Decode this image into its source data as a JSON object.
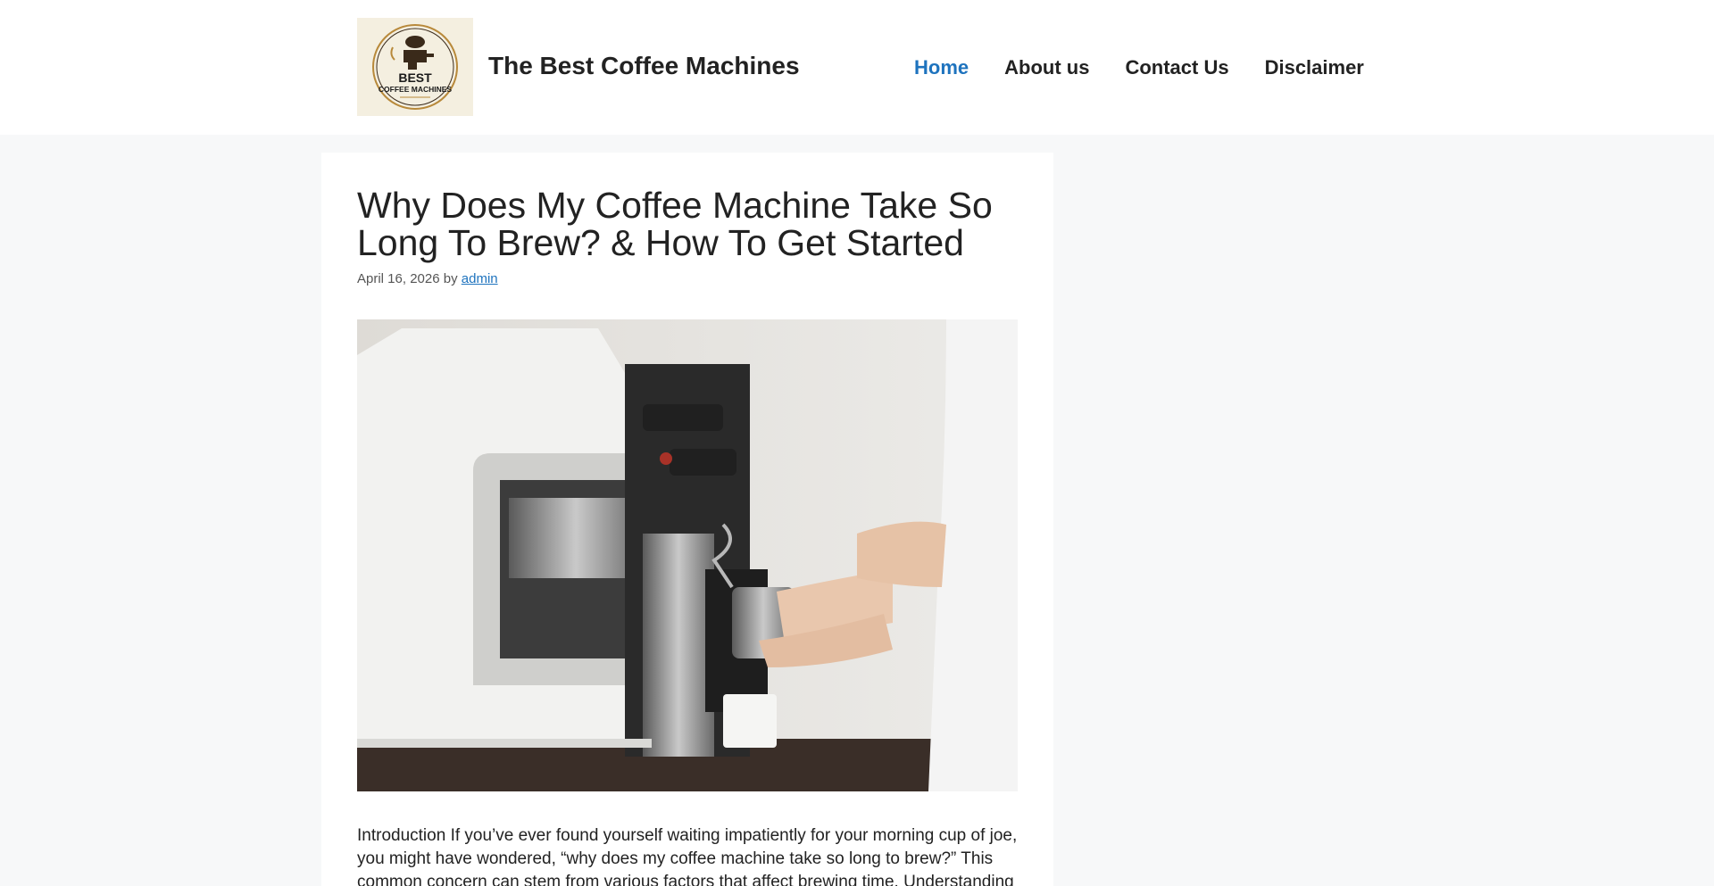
{
  "header": {
    "logo_text": [
      "BEST",
      "COFFEE MACHINES"
    ],
    "site_title": "The Best Coffee Machines"
  },
  "nav": {
    "items": [
      {
        "label": "Home",
        "active": true
      },
      {
        "label": "About us",
        "active": false
      },
      {
        "label": "Contact Us",
        "active": false
      },
      {
        "label": "Disclaimer",
        "active": false
      }
    ]
  },
  "article": {
    "title": "Why Does My Coffee Machine Take So Long To Brew? & How To Get Started",
    "date": "April 16, 2026",
    "by": "by",
    "author": "admin",
    "intro": "Introduction If you’ve ever found yourself waiting impatiently for your morning cup of joe, you might have wondered, “why does my coffee machine take so long to brew?” This common concern can stem from various factors that affect brewing time. Understanding"
  },
  "colors": {
    "accent": "#1e73be",
    "page_background": "#f7f8f9",
    "text": "#222222"
  }
}
